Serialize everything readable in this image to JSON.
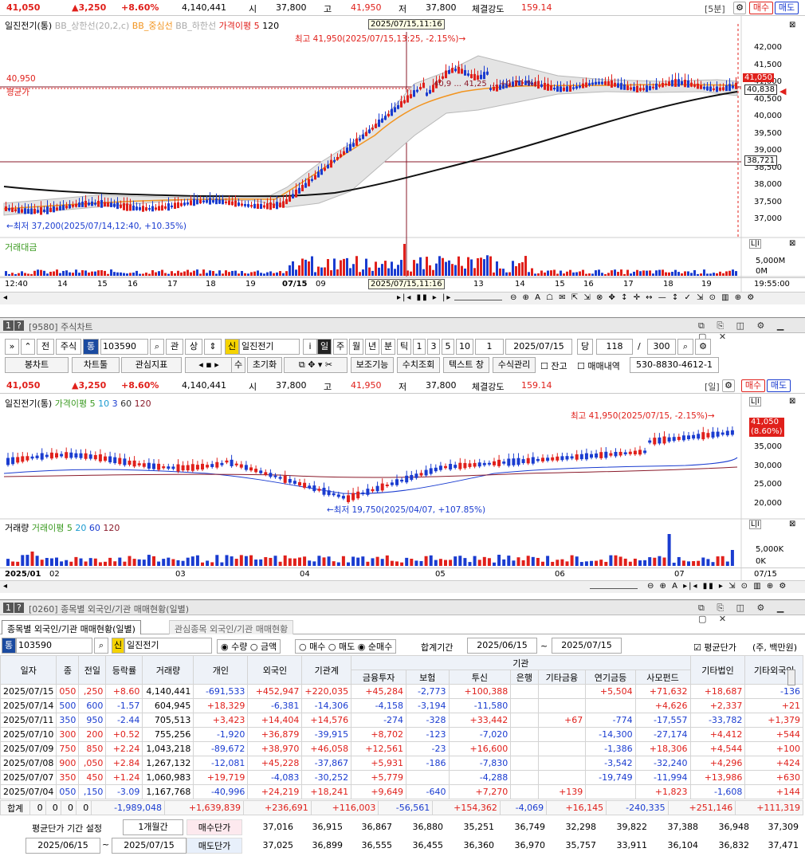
{
  "top_info": {
    "price": "41,050",
    "change": "▲3,250",
    "pct": "+8.60%",
    "volume": "4,140,441",
    "open_label": "시",
    "open": "37,800",
    "high_label": "고",
    "high": "41,950",
    "low_label": "저",
    "low": "37,800",
    "strength_label": "체결강도",
    "strength": "159.14",
    "interval": "[5분]",
    "buy": "매수",
    "sell": "매도"
  },
  "chart1": {
    "legend": {
      "name": "일진전기(통)",
      "bb_upper": "BB_상한선(20,2,c)",
      "bb_mid": "BB_중심선",
      "bb_lower": "BB_하한선",
      "ma_label": "가격이평 5",
      "ma2": "120"
    },
    "cursor_time": "2025/07/15,11:16",
    "high_note": "최고 41,950(2025/07/15,13:25, -2.15%)→",
    "low_note": "←최저 37,200(2025/07/14,12:40, +10.35%)",
    "avg_price_value": "40,950",
    "avg_price_label": "평균가",
    "price_tag_current": "41,050",
    "price_tag_cursor": "40,838",
    "price_tag_low": "38,721",
    "mid_note": "40,9 ...  41,25 ... +0,71 %)",
    "y_ticks": [
      "42,000",
      "41,500",
      "41,000",
      "40,500",
      "40,000",
      "39,500",
      "39,000",
      "38,500",
      "38,000",
      "37,500",
      "37,000"
    ],
    "vol_legend": "거래대금",
    "vol_ticks": [
      "5,000M",
      "0M"
    ],
    "x_ticks": [
      "12:40",
      "14",
      "15",
      "16",
      "17",
      "18",
      "19",
      "07/15",
      "09",
      "10",
      "13",
      "14",
      "15",
      "16",
      "17",
      "18",
      "19"
    ],
    "x_cursor": "2025/07/15,11:16",
    "x_end": "19:55:00"
  },
  "window2": {
    "code_label": "1",
    "title": "[9580] 주식차트",
    "toolbar1": {
      "prev": "전",
      "stock": "주식",
      "tong": "통",
      "code": "103590",
      "gwan": "관",
      "sang": "상",
      "sin": "신",
      "name": "일진전기",
      "i": "i",
      "periods": [
        "일",
        "주",
        "월",
        "년",
        "분",
        "틱",
        "1",
        "3",
        "5",
        "10"
      ],
      "count_box": "1",
      "date": "2025/07/15",
      "dang": "당",
      "bars": "118",
      "slash": "/",
      "total": "300"
    },
    "toolbar2": {
      "bongchart": "봉차트",
      "chart_tools": "차트툴",
      "indicators": "관심지표",
      "su": "수",
      "reset": "초기화",
      "aux": "보조기능",
      "numeric": "수치조회",
      "text_window": "텍스트 창",
      "formula": "수식관리",
      "jango": "잔고",
      "trades": "매매내역",
      "account": "530-8830-4612-1"
    }
  },
  "chart2": {
    "info": {
      "price": "41,050",
      "change": "▲3,250",
      "pct": "+8.60%",
      "volume": "4,140,441",
      "open": "37,800",
      "high": "41,950",
      "low": "37,800",
      "strength": "159.14",
      "interval": "[일]"
    },
    "legend": {
      "name": "일진전기(통)",
      "ma": "가격이평 5",
      "m10": "10",
      "m3": "3",
      "m60": "60",
      "m120": "120"
    },
    "high_note": "최고 41,950(2025/07/15, -2.15%)→",
    "low_note": "←최저 19,750(2025/04/07, +107.85%)",
    "tag_price": "41,050",
    "tag_pct": "(8.60%)",
    "y_ticks": [
      "35,000",
      "30,000",
      "25,000",
      "20,000"
    ],
    "vol_legend": "거래량",
    "vol_ma": "거래이평 5",
    "v20": "20",
    "v60": "60",
    "v120": "120",
    "vol_ticks": [
      "5,000K",
      "0K"
    ],
    "x_ticks": [
      "2025/01",
      "02",
      "03",
      "04",
      "05",
      "06",
      "07"
    ],
    "x_end": "07/15"
  },
  "window3": {
    "code_label": "1",
    "title": "[0260] 종목별 외국인/기관 매매현황(일별)",
    "tab1": "종목별 외국인/기관 매매현황(일별)",
    "tab2": "관심종목 외국인/기관 매매현황",
    "tong": "통",
    "code": "103590",
    "sin": "신",
    "name": "일진전기",
    "radio1": [
      "수량",
      "금액"
    ],
    "radio2": [
      "매수",
      "매도",
      "순매수"
    ],
    "period_label": "합계기간",
    "from": "2025/06/15",
    "to": "2025/07/15",
    "avg_chk": "평균단가",
    "unit": "(주, 백만원)"
  },
  "table": {
    "headers": [
      "일자",
      "종",
      "전일",
      "등락률",
      "거래량",
      "개인",
      "외국인",
      "기관계"
    ],
    "inst_header": "기관",
    "inst_sub": [
      "금융투자",
      "보험",
      "투신",
      "은행",
      "기타금융",
      "연기금등",
      "사모펀드"
    ],
    "tail_headers": [
      "기타법인",
      "기타외국인"
    ],
    "rows": [
      [
        "2025/07/15",
        "050",
        ",250",
        "+8.60",
        "4,140,441",
        "-691,533",
        "+452,947",
        "+220,035",
        "+45,284",
        "-2,773",
        "+100,388",
        "",
        "",
        "+5,504",
        "+71,632",
        "+18,687",
        "-136"
      ],
      [
        "2025/07/14",
        "500",
        "600",
        "-1.57",
        "604,945",
        "+18,329",
        "-6,381",
        "-14,306",
        "-4,158",
        "-3,194",
        "-11,580",
        "",
        "",
        "",
        "+4,626",
        "+2,337",
        "+21"
      ],
      [
        "2025/07/11",
        "350",
        "950",
        "-2.44",
        "705,513",
        "+3,423",
        "+14,404",
        "+14,576",
        "-274",
        "-328",
        "+33,442",
        "",
        "+67",
        "-774",
        "-17,557",
        "-33,782",
        "+1,379"
      ],
      [
        "2025/07/10",
        "300",
        "200",
        "+0.52",
        "755,256",
        "-1,920",
        "+36,879",
        "-39,915",
        "+8,702",
        "-123",
        "-7,020",
        "",
        "",
        "-14,300",
        "-27,174",
        "+4,412",
        "+544"
      ],
      [
        "2025/07/09",
        "750",
        "850",
        "+2.24",
        "1,043,218",
        "-89,672",
        "+38,970",
        "+46,058",
        "+12,561",
        "-23",
        "+16,600",
        "",
        "",
        "-1,386",
        "+18,306",
        "+4,544",
        "+100"
      ],
      [
        "2025/07/08",
        "900",
        ",050",
        "+2.84",
        "1,267,132",
        "-12,081",
        "+45,228",
        "-37,867",
        "+5,931",
        "-186",
        "-7,830",
        "",
        "",
        "-3,542",
        "-32,240",
        "+4,296",
        "+424"
      ],
      [
        "2025/07/07",
        "350",
        "450",
        "+1.24",
        "1,060,983",
        "+19,719",
        "-4,083",
        "-30,252",
        "+5,779",
        "",
        "-4,288",
        "",
        "",
        "-19,749",
        "-11,994",
        "+13,986",
        "+630"
      ],
      [
        "2025/07/04",
        "050",
        ",150",
        "-3.09",
        "1,167,768",
        "-40,996",
        "+24,219",
        "+18,241",
        "+9,649",
        "-640",
        "+7,270",
        "",
        "+139",
        "",
        "+1,823",
        "-1,608",
        "+144"
      ]
    ],
    "total": [
      "합계",
      "0",
      "0",
      "0",
      "0",
      "-1,989,048",
      "+1,639,839",
      "+236,691",
      "+116,003",
      "-56,561",
      "+154,362",
      "-4,069",
      "+16,145",
      "-240,335",
      "+251,146",
      "+111,319"
    ],
    "avg_label": "평균단가 기간 설정",
    "avg_period": "1개월간",
    "buy_label": "매수단가",
    "sell_label": "매도단가",
    "avg_from": "2025/06/15",
    "avg_to": "2025/07/15",
    "buy_row": [
      "37,016",
      "36,915",
      "36,867",
      "36,880",
      "35,251",
      "36,749",
      "32,298",
      "39,822",
      "37,388",
      "36,948",
      "37,309"
    ],
    "sell_row": [
      "37,025",
      "36,899",
      "36,555",
      "36,455",
      "36,360",
      "36,970",
      "35,757",
      "33,911",
      "36,104",
      "36,832",
      "37,471"
    ]
  }
}
